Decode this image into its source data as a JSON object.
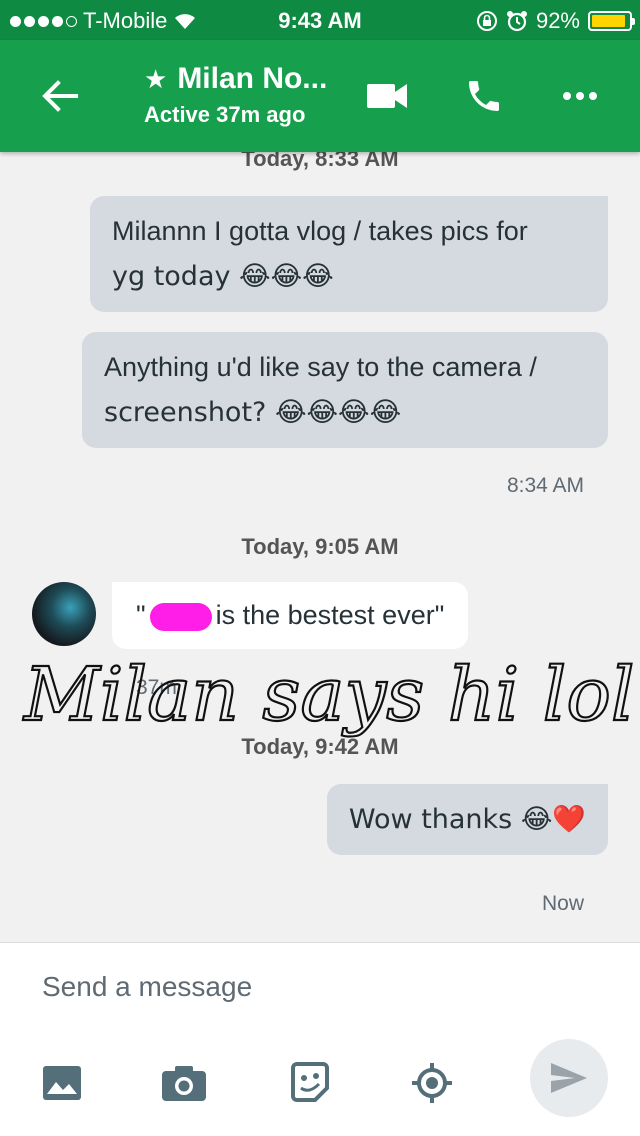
{
  "status": {
    "carrier": "T-Mobile",
    "time": "9:43 AM",
    "battery": "92%",
    "battery_level": 0.92
  },
  "header": {
    "title": "Milan No...",
    "subtitle": "Active 37m ago"
  },
  "messages": {
    "ts_top": "Today, 8:33 AM",
    "out1": "Milannn I gotta vlog / takes pics for yg today 😂😂😂",
    "out1_line1": "Milannn I gotta vlog / takes pics for",
    "out1_line2": "yg today 😂😂😂",
    "out2_line1": "Anything u'd like say to the camera /",
    "out2_line2": "screenshot? 😂😂😂😂",
    "out2_time": "8:34 AM",
    "ts_mid": "Today, 9:05 AM",
    "in1_pre": "\"",
    "in1_post": "is the bestest ever\"",
    "in1_time": "37m",
    "ts_late": "Today, 9:42 AM",
    "out3": "Wow thanks 😂❤️",
    "out3_time": "Now",
    "handwriting": "Milan says hi lol"
  },
  "composer": {
    "placeholder": "Send a message"
  },
  "colors": {
    "status_bar": "#0f8a43",
    "app_bar": "#16a04e",
    "outgoing_bubble": "#d4dae0",
    "incoming_bubble": "#ffffff"
  }
}
